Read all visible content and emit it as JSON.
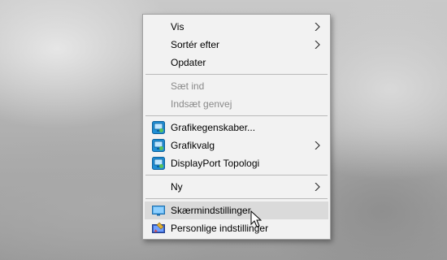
{
  "menu": {
    "items": [
      {
        "label": "Vis",
        "has_submenu": true,
        "enabled": true
      },
      {
        "label": "Sortér efter",
        "has_submenu": true,
        "enabled": true
      },
      {
        "label": "Opdater",
        "has_submenu": false,
        "enabled": true
      },
      {
        "label": "Sæt ind",
        "has_submenu": false,
        "enabled": false
      },
      {
        "label": "Indsæt genvej",
        "has_submenu": false,
        "enabled": false
      },
      {
        "label": "Grafikegenskaber...",
        "has_submenu": false,
        "enabled": true,
        "icon": "intel-graphics-icon"
      },
      {
        "label": "Grafikvalg",
        "has_submenu": true,
        "enabled": true,
        "icon": "intel-graphics-icon"
      },
      {
        "label": "DisplayPort Topologi",
        "has_submenu": false,
        "enabled": true,
        "icon": "intel-graphics-icon"
      },
      {
        "label": "Ny",
        "has_submenu": true,
        "enabled": true
      },
      {
        "label": "Skærmindstillinger",
        "has_submenu": false,
        "enabled": true,
        "icon": "display-settings-icon",
        "hovered": true
      },
      {
        "label": "Personlige indstillinger",
        "has_submenu": false,
        "enabled": true,
        "icon": "personalize-icon"
      }
    ]
  },
  "colors": {
    "menu_background": "#f2f2f2",
    "hover_background": "#dadada",
    "disabled_text": "#8a8a8a"
  }
}
